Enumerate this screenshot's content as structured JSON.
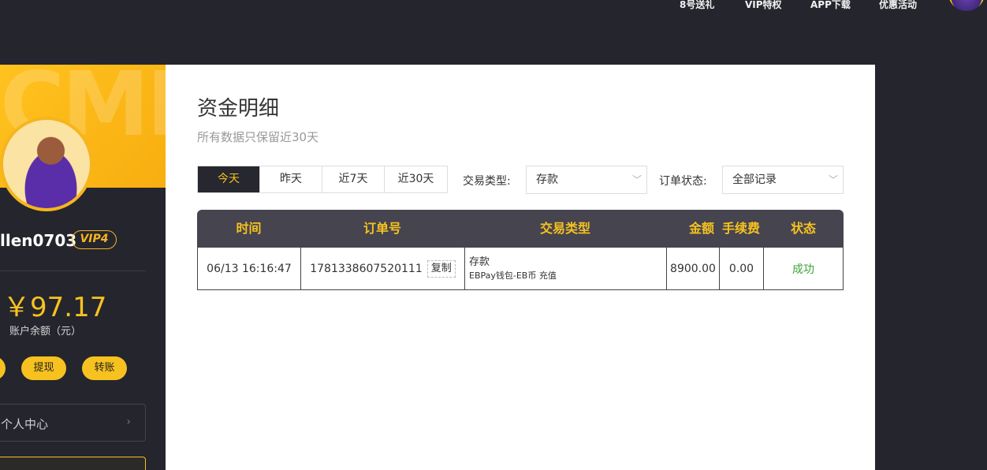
{
  "topnav": {
    "items": [
      "8号送礼",
      "VIP特权",
      "APP下载",
      "优惠活动"
    ]
  },
  "sidebar": {
    "banner_watermark": "CMF",
    "username": "llen0703",
    "vip_level": "VIP4",
    "balance": "￥97.17",
    "balance_label": "账户余额（元）",
    "actions": {
      "withdraw": "提现",
      "transfer": "转账"
    },
    "menu": {
      "personal_center": "个人中心",
      "chevron": "›"
    }
  },
  "main": {
    "title": "资金明细",
    "subtitle": "所有数据只保留近30天",
    "range_tabs": [
      {
        "label": "今天",
        "active": true
      },
      {
        "label": "昨天",
        "active": false
      },
      {
        "label": "近7天",
        "active": false
      },
      {
        "label": "近30天",
        "active": false
      }
    ],
    "filters": {
      "type_label": "交易类型:",
      "type_value": "存款",
      "status_label": "订单状态:",
      "status_value": "全部记录"
    },
    "table": {
      "headers": [
        "时间",
        "订单号",
        "交易类型",
        "金额",
        "手续费",
        "状态"
      ],
      "rows": [
        {
          "time": "06/13 16:16:47",
          "order_no": "1781338607520111",
          "copy_label": "复制",
          "type_main": "存款",
          "type_detail": "EBPay钱包-EB币 充值",
          "amount": "8900.00",
          "fee": "0.00",
          "status": "成功"
        }
      ]
    }
  },
  "colors": {
    "accent": "#f7c21f",
    "dark": "#25252e",
    "header_bg": "#45444f",
    "success": "#3aa53a"
  }
}
